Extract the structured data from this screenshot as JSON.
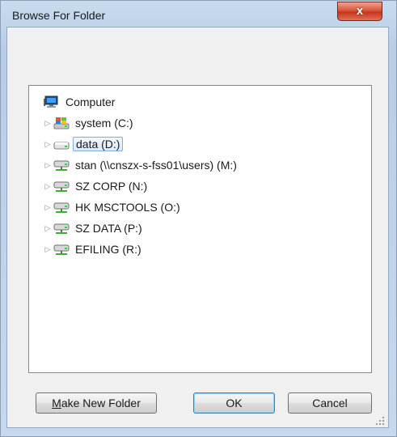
{
  "window": {
    "title": "Browse For Folder",
    "close_glyph": "x"
  },
  "tree": {
    "root": {
      "label": "Computer",
      "icon": "computer-icon"
    },
    "items": [
      {
        "label": "system (C:)",
        "icon": "system-drive-icon",
        "selected": false
      },
      {
        "label": "data (D:)",
        "icon": "local-drive-icon",
        "selected": true
      },
      {
        "label": "stan (\\\\cnszx-s-fss01\\users) (M:)",
        "icon": "network-drive-icon",
        "selected": false
      },
      {
        "label": "SZ CORP (N:)",
        "icon": "network-drive-icon",
        "selected": false
      },
      {
        "label": "HK MSCTOOLS (O:)",
        "icon": "network-drive-icon",
        "selected": false
      },
      {
        "label": "SZ DATA (P:)",
        "icon": "network-drive-icon",
        "selected": false
      },
      {
        "label": "EFILING (R:)",
        "icon": "network-drive-icon",
        "selected": false
      }
    ]
  },
  "buttons": {
    "make_new_folder_hotkey": "M",
    "make_new_folder_rest": "ake New Folder",
    "ok": "OK",
    "cancel": "Cancel"
  },
  "colors": {
    "selection_border": "#84acdd",
    "close_red": "#c8341a",
    "frame_blue": "#b8cde6"
  }
}
